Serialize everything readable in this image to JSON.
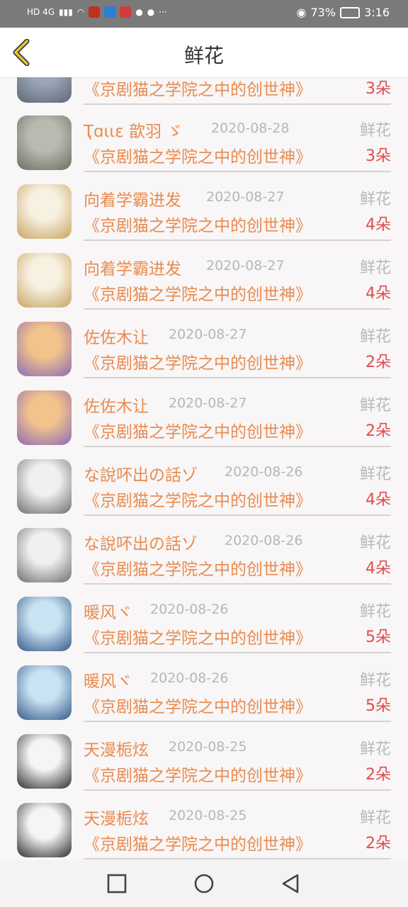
{
  "status_bar": {
    "left_text": "HD 4G",
    "battery": "73%",
    "time": "3:16",
    "more_icon": "···"
  },
  "header": {
    "title": "鲜花"
  },
  "rows": [
    {
      "name": "",
      "date": "",
      "gift_label": "",
      "book": "《京剧猫之学院之中的创世神》",
      "count": "3朵",
      "avatar_colors": [
        "#9aa6b6",
        "#5f6775"
      ]
    },
    {
      "name": "Ҭɑιιε 歆羽 ゞ",
      "date": "2020-08-28",
      "gift_label": "鲜花",
      "book": "《京剧猫之学院之中的创世神》",
      "count": "3朵",
      "avatar_colors": [
        "#b9bbb0",
        "#6b7062"
      ]
    },
    {
      "name": "向着学霸进发",
      "date": "2020-08-27",
      "gift_label": "鲜花",
      "book": "《京剧猫之学院之中的创世神》",
      "count": "4朵",
      "avatar_colors": [
        "#f7f1e2",
        "#c8a45e"
      ]
    },
    {
      "name": "向着学霸进发",
      "date": "2020-08-27",
      "gift_label": "鲜花",
      "book": "《京剧猫之学院之中的创世神》",
      "count": "4朵",
      "avatar_colors": [
        "#f7f1e2",
        "#c8a45e"
      ]
    },
    {
      "name": "佐佐木让",
      "date": "2020-08-27",
      "gift_label": "鲜花",
      "book": "《京剧猫之学院之中的创世神》",
      "count": "2朵",
      "avatar_colors": [
        "#f2c38b",
        "#8c6bb6"
      ]
    },
    {
      "name": "佐佐木让",
      "date": "2020-08-27",
      "gift_label": "鲜花",
      "book": "《京剧猫之学院之中的创世神》",
      "count": "2朵",
      "avatar_colors": [
        "#f2c38b",
        "#8c6bb6"
      ]
    },
    {
      "name": "な說吥出の話ゾ",
      "date": "2020-08-26",
      "gift_label": "鲜花",
      "book": "《京剧猫之学院之中的创世神》",
      "count": "4朵",
      "avatar_colors": [
        "#f0f0f0",
        "#6e6e6e"
      ]
    },
    {
      "name": "な說吥出の話ゾ",
      "date": "2020-08-26",
      "gift_label": "鲜花",
      "book": "《京剧猫之学院之中的创世神》",
      "count": "4朵",
      "avatar_colors": [
        "#f0f0f0",
        "#6e6e6e"
      ]
    },
    {
      "name": "暖风ヾ",
      "date": "2020-08-26",
      "gift_label": "鲜花",
      "book": "《京剧猫之学院之中的创世神》",
      "count": "5朵",
      "avatar_colors": [
        "#c9e3f2",
        "#365a8a"
      ]
    },
    {
      "name": "暖风ヾ",
      "date": "2020-08-26",
      "gift_label": "鲜花",
      "book": "《京剧猫之学院之中的创世神》",
      "count": "5朵",
      "avatar_colors": [
        "#c9e3f2",
        "#365a8a"
      ]
    },
    {
      "name": "天漫栀炫",
      "date": "2020-08-25",
      "gift_label": "鲜花",
      "book": "《京剧猫之学院之中的创世神》",
      "count": "2朵",
      "avatar_colors": [
        "#f5f5f5",
        "#2e2e2e"
      ]
    },
    {
      "name": "天漫栀炫",
      "date": "2020-08-25",
      "gift_label": "鲜花",
      "book": "《京剧猫之学院之中的创世神》",
      "count": "2朵",
      "avatar_colors": [
        "#f5f5f5",
        "#2e2e2e"
      ]
    }
  ]
}
